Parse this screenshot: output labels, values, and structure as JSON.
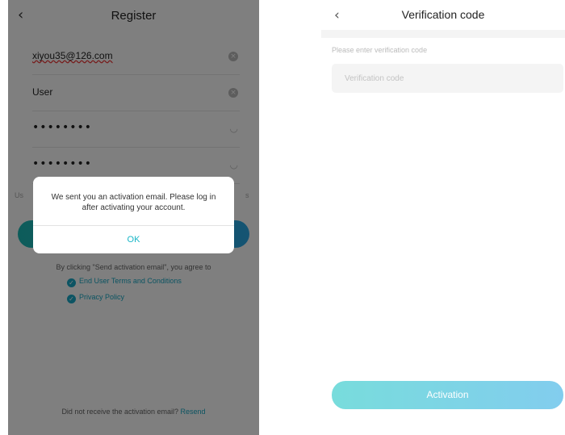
{
  "register_screen": {
    "title": "Register",
    "back_icon": "chevron-left-icon",
    "email_value": "xiyou35@126.com",
    "username_value": "User",
    "password_value": "••••••••",
    "confirm_password_value": "••••••••",
    "hint_left": "Us",
    "hint_right": "s",
    "agree_text": "By clicking \"Send activation email\", you agree to",
    "terms_link": "End User Terms and Conditions",
    "privacy_link": "Privacy Policy",
    "resend_prompt": "Did not receive the activation email?",
    "resend_link": "Resend",
    "brand_gradient": [
      "#1bb9b5",
      "#2aa8e6"
    ]
  },
  "dialog": {
    "message": "We sent you an activation email. Please log in after activating your account.",
    "ok_label": "OK",
    "ok_color": "#18b6c7"
  },
  "verification_screen": {
    "title": "Verification code",
    "back_icon": "chevron-left-icon",
    "field_label": "Please enter verification code",
    "code_placeholder": "Verification code",
    "activation_label": "Activation",
    "button_gradient": [
      "#78dcdc",
      "#82cdee"
    ]
  }
}
